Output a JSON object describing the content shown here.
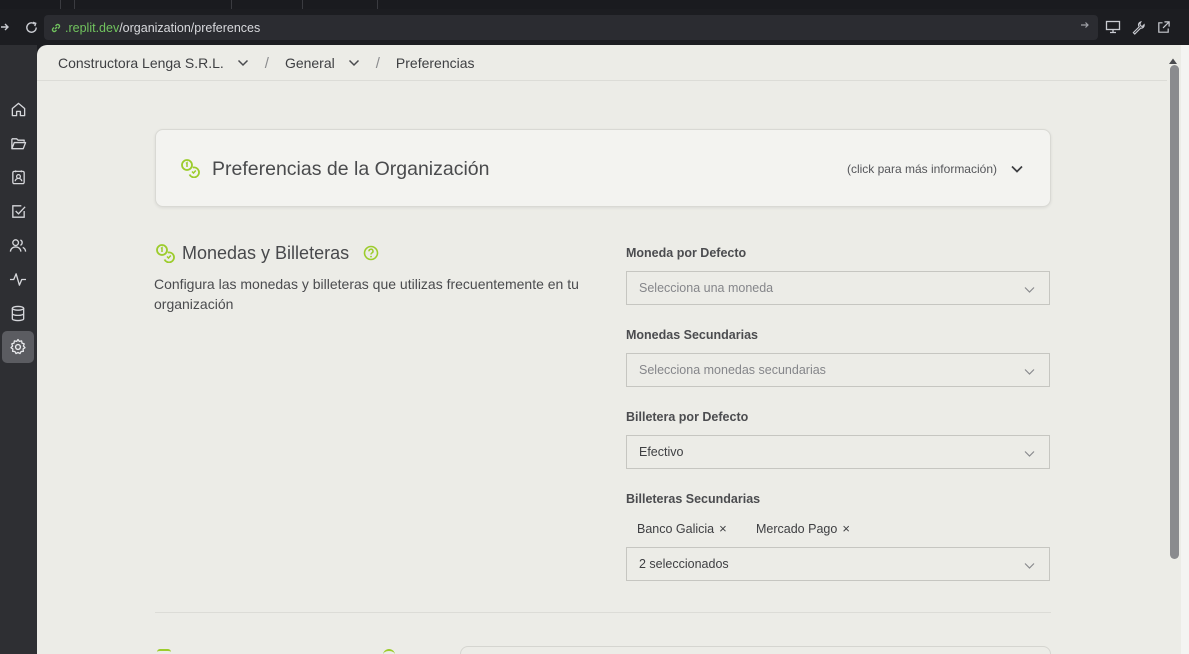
{
  "browser": {
    "url_host": ".replit.dev",
    "url_path": "/organization/preferences"
  },
  "sidebar": {
    "items": [
      {
        "icon": "home-icon"
      },
      {
        "icon": "folder-icon"
      },
      {
        "icon": "contacts-icon"
      },
      {
        "icon": "tasks-icon"
      },
      {
        "icon": "users-icon"
      },
      {
        "icon": "activity-icon"
      },
      {
        "icon": "database-icon"
      },
      {
        "icon": "gear-icon",
        "active": true
      }
    ]
  },
  "breadcrumb": {
    "organization": "Constructora Lenga S.R.L.",
    "separator": "/",
    "section": "General",
    "page": "Preferencias"
  },
  "header_card": {
    "title": "Preferencias de la Organización",
    "info": "(click para más información)"
  },
  "section": {
    "title": "Monedas y Billeteras",
    "description": "Configura las monedas y billeteras que utilizas frecuentemente en tu organización"
  },
  "fields": {
    "default_currency": {
      "label": "Moneda por Defecto",
      "placeholder": "Selecciona una moneda"
    },
    "secondary_currencies": {
      "label": "Monedas Secundarias",
      "placeholder": "Selecciona monedas secundarias"
    },
    "default_wallet": {
      "label": "Billetera por Defecto",
      "value": "Efectivo"
    },
    "secondary_wallets": {
      "label": "Billeteras Secundarias",
      "chips": [
        "Banco Galicia",
        "Mercado Pago"
      ],
      "chip_remove": "×",
      "value": "2 seleccionados"
    }
  },
  "colors": {
    "accent": "#9ccc2c",
    "url_host": "#71c35e",
    "background": "#ecece7",
    "sidebar": "#2e2f33"
  }
}
